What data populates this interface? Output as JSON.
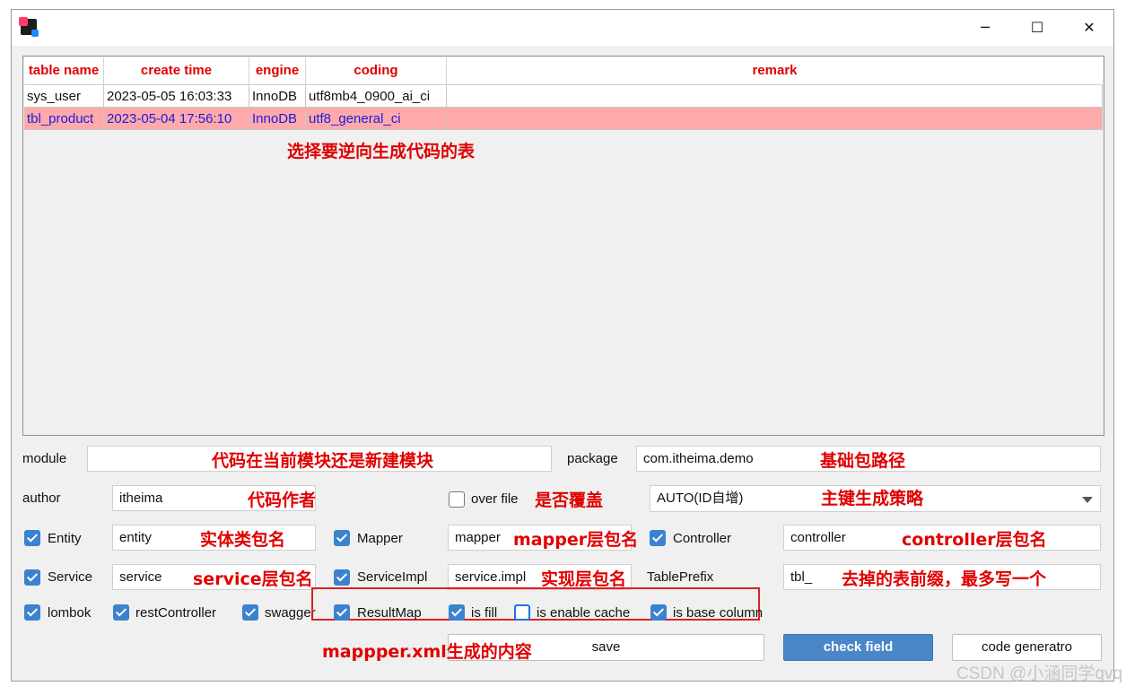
{
  "window": {
    "minimize": "─",
    "maximize": "☐",
    "close": "✕"
  },
  "table": {
    "headers": [
      "table name",
      "create time",
      "engine",
      "coding",
      "remark"
    ],
    "rows": [
      [
        "sys_user",
        "2023-05-05 16:03:33",
        "InnoDB",
        "utf8mb4_0900_ai_ci",
        ""
      ],
      [
        "tbl_product",
        "2023-05-04 17:56:10",
        "InnoDB",
        "utf8_general_ci",
        ""
      ]
    ],
    "annotation": "选择要逆向生成代码的表"
  },
  "form": {
    "module": {
      "label": "module",
      "value": "",
      "annotation": "代码在当前模块还是新建模块"
    },
    "package": {
      "label": "package",
      "value": "com.itheima.demo",
      "annotation": "基础包路径"
    },
    "author": {
      "label": "author",
      "value": "itheima",
      "annotation": "代码作者"
    },
    "overfile": {
      "label": "over file",
      "checked": false,
      "annotation": "是否覆盖"
    },
    "idtype": {
      "value": "AUTO(ID自增)",
      "annotation": "主键生成策略"
    },
    "entity": {
      "label": "Entity",
      "checked": true,
      "value": "entity",
      "annotation": "实体类包名"
    },
    "mapper": {
      "label": "Mapper",
      "checked": true,
      "value": "mapper",
      "annotation_bold": "mapper",
      "annotation": "层包名"
    },
    "controller": {
      "label": "Controller",
      "checked": true,
      "value": "controller",
      "annotation_bold": "controller",
      "annotation": "层包名"
    },
    "service": {
      "label": "Service",
      "checked": true,
      "value": "service",
      "annotation_bold": "service",
      "annotation": "层包名"
    },
    "serviceimpl": {
      "label": "ServiceImpl",
      "checked": true,
      "value": "service.impl",
      "annotation": "实现层包名"
    },
    "tableprefix": {
      "label": "TablePrefix",
      "value": "tbl_",
      "annotation": "去掉的表前缀，最多写一个"
    },
    "options": [
      {
        "label": "lombok",
        "checked": true
      },
      {
        "label": "restController",
        "checked": true
      },
      {
        "label": "swagger",
        "checked": true
      },
      {
        "label": "ResultMap",
        "checked": true
      },
      {
        "label": "is fill",
        "checked": true
      },
      {
        "label": "is enable cache",
        "checked": false
      },
      {
        "label": "is base column",
        "checked": true
      }
    ],
    "xml_annotation_bold": "mappper.xml",
    "xml_annotation": "生成的内容"
  },
  "buttons": {
    "save": "save",
    "check": "check field",
    "generate": "code generatro"
  },
  "watermark": "CSDN @小涵同学qvq",
  "colors": {
    "annotation": "#e00000",
    "selected_row": "#ffaaaa",
    "checkbox": "#3b82cf",
    "primary_button": "#4a86c8"
  }
}
